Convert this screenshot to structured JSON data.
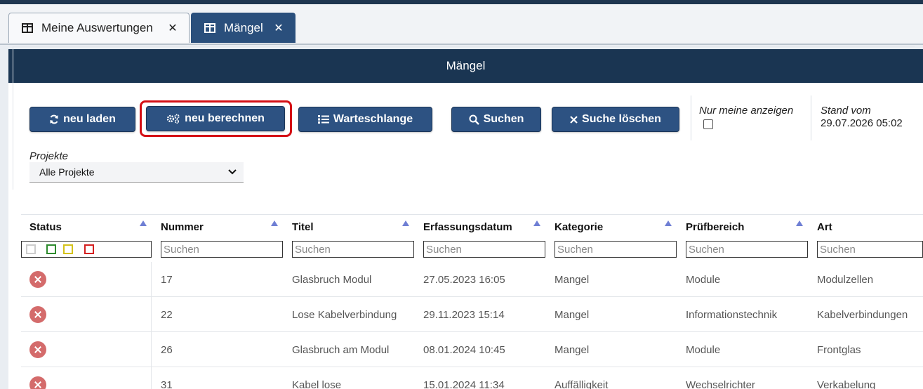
{
  "tabs": [
    {
      "label": "Meine Auswertungen",
      "active": false
    },
    {
      "label": "Mängel",
      "active": true
    }
  ],
  "panel": {
    "title": "Mängel"
  },
  "toolbar": {
    "reload_label": "neu laden",
    "recalc_label": "neu berechnen",
    "queue_label": "Warteschlange",
    "search_label": "Suchen",
    "clear_search_label": "Suche löschen"
  },
  "only_mine": {
    "label": "Nur meine anzeigen",
    "checked": false
  },
  "stand": {
    "label": "Stand vom",
    "value": "29.07.2026 05:02"
  },
  "projects": {
    "label": "Projekte",
    "selected": "Alle Projekte"
  },
  "table": {
    "columns": [
      "Status",
      "Nummer",
      "Titel",
      "Erfassungsdatum",
      "Kategorie",
      "Prüfbereich",
      "Art"
    ],
    "filter_placeholder": "Suchen",
    "status_filter_colors": [
      "#cccccc",
      "#2e8b2e",
      "#d4c21a",
      "#d42020"
    ],
    "status_color": "#d46b6b",
    "rows": [
      {
        "nummer": "17",
        "titel": "Glasbruch Modul",
        "datum": "27.05.2023 16:05",
        "kategorie": "Mangel",
        "pruefbereich": "Module",
        "art": "Modulzellen"
      },
      {
        "nummer": "22",
        "titel": "Lose Kabelverbindung",
        "datum": "29.11.2023 15:14",
        "kategorie": "Mangel",
        "pruefbereich": "Informationstechnik",
        "art": "Kabelverbindungen"
      },
      {
        "nummer": "26",
        "titel": "Glasbruch am Modul",
        "datum": "08.01.2024 10:45",
        "kategorie": "Mangel",
        "pruefbereich": "Module",
        "art": "Frontglas"
      },
      {
        "nummer": "31",
        "titel": "Kabel lose",
        "datum": "15.01.2024 11:34",
        "kategorie": "Auffälligkeit",
        "pruefbereich": "Wechselrichter",
        "art": "Verkabelung"
      }
    ]
  },
  "colors": {
    "header_bg": "#1a3552",
    "button_bg": "#2d5282",
    "active_tab_bg": "#2a4f7c",
    "highlight": "#d40f14"
  }
}
